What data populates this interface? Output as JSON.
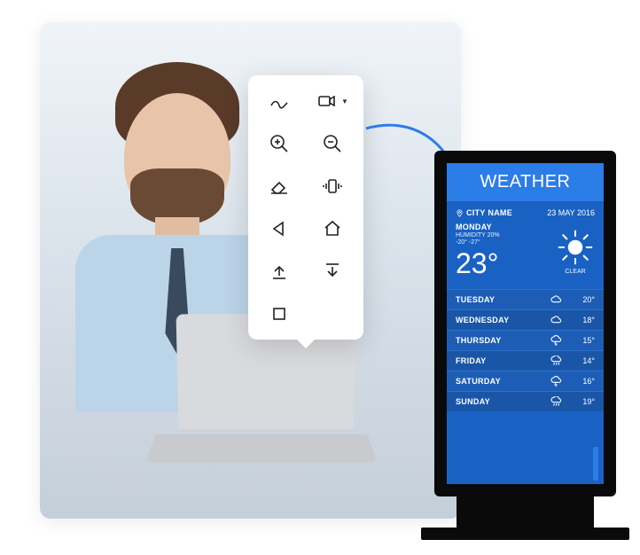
{
  "toolbar": {
    "items": [
      {
        "name": "draw-icon"
      },
      {
        "name": "video-icon",
        "hasDropdown": true
      },
      {
        "name": "zoom-in-icon"
      },
      {
        "name": "zoom-out-icon"
      },
      {
        "name": "eraser-icon"
      },
      {
        "name": "vibrate-icon"
      },
      {
        "name": "back-icon"
      },
      {
        "name": "home-icon"
      },
      {
        "name": "upload-icon"
      },
      {
        "name": "download-icon"
      },
      {
        "name": "stop-icon"
      }
    ]
  },
  "weather": {
    "title": "WEATHER",
    "city": "CITY NAME",
    "date": "23 MAY 2016",
    "today": {
      "day": "MONDAY",
      "humidity": "HUMIDITY 20%",
      "range": "-20° -27°",
      "temp": "23°",
      "condition": "CLEAR"
    },
    "forecast": [
      {
        "day": "TUESDAY",
        "icon": "cloud",
        "temp": "20°"
      },
      {
        "day": "WEDNESDAY",
        "icon": "cloud",
        "temp": "18°"
      },
      {
        "day": "THURSDAY",
        "icon": "storm",
        "temp": "15°"
      },
      {
        "day": "FRIDAY",
        "icon": "rain",
        "temp": "14°"
      },
      {
        "day": "SATURDAY",
        "icon": "storm",
        "temp": "16°"
      },
      {
        "day": "SUNDAY",
        "icon": "rain",
        "temp": "19°"
      }
    ]
  }
}
